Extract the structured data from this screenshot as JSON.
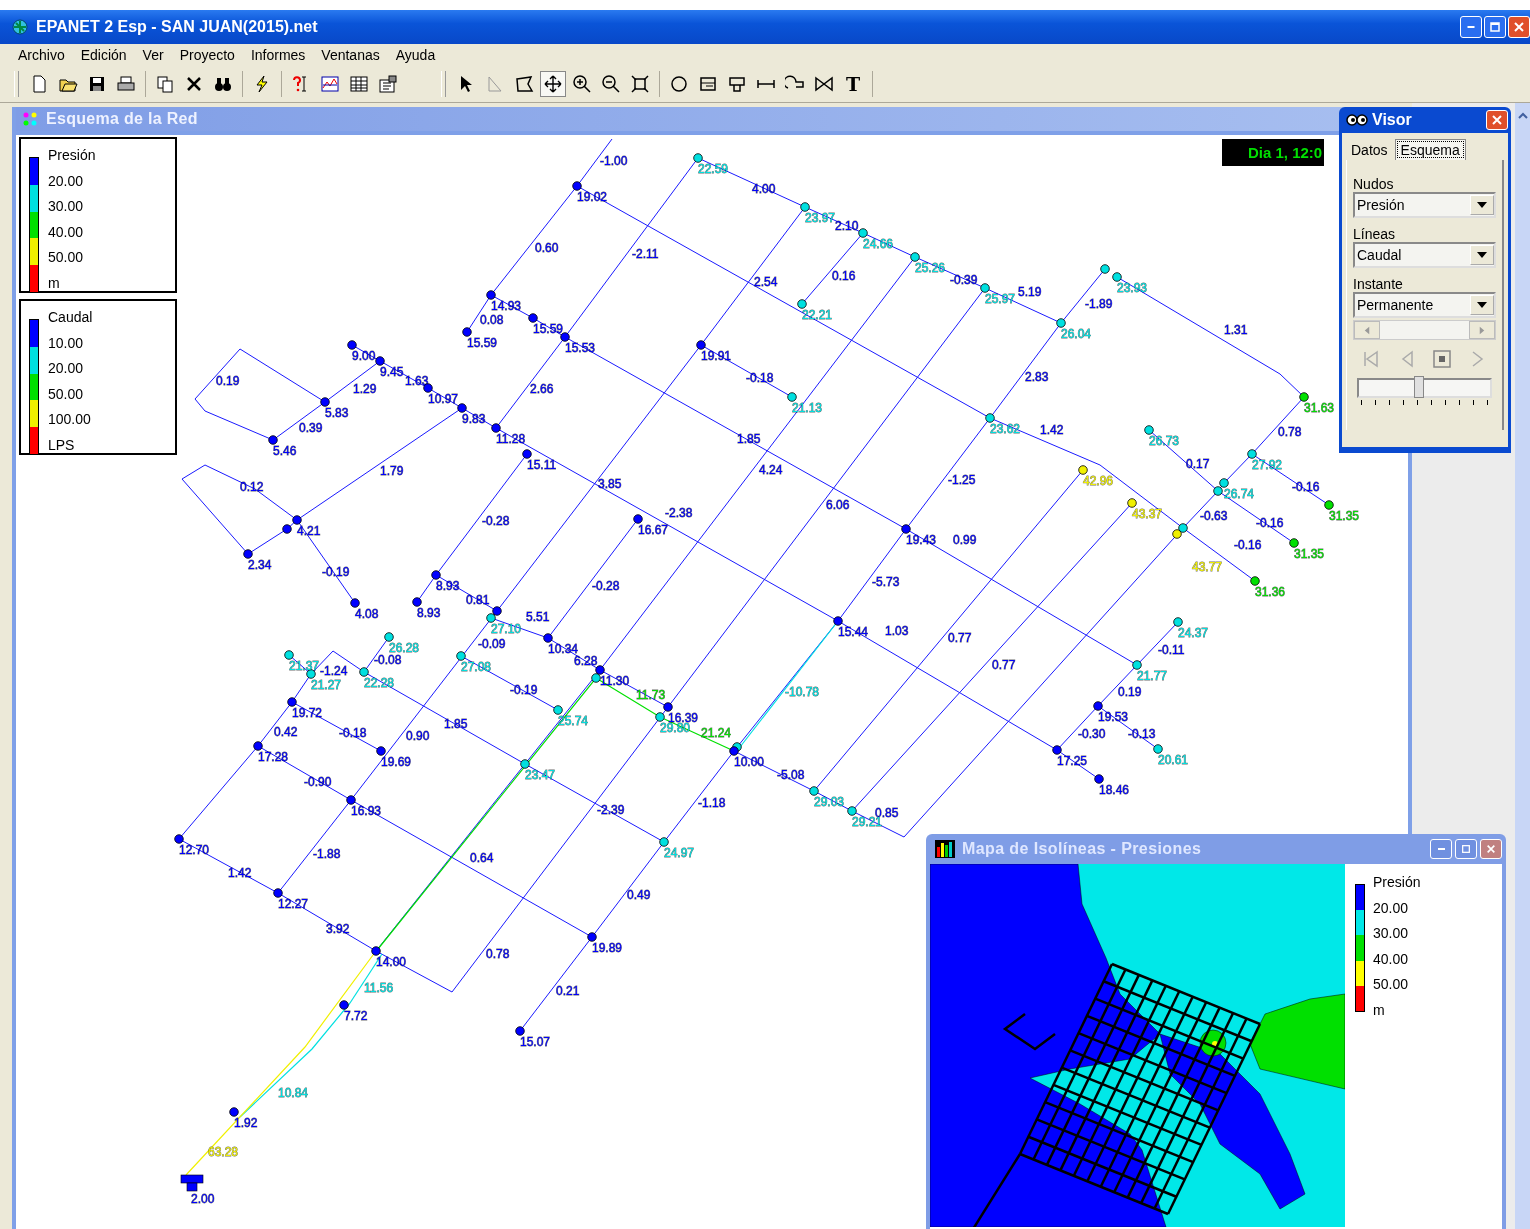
{
  "window": {
    "title": "EPANET 2 Esp - SAN JUAN(2015).net"
  },
  "menu": [
    "Archivo",
    "Edición",
    "Ver",
    "Proyecto",
    "Informes",
    "Ventanas",
    "Ayuda"
  ],
  "toolbar": {
    "text_tool": "T"
  },
  "network_map": {
    "title": "Esquema de la Red",
    "time_display": "Dia 1, 12:0",
    "pressure_legend": {
      "title": "Presión",
      "breaks": [
        "20.00",
        "30.00",
        "40.00",
        "50.00"
      ],
      "unit": "m",
      "bands": [
        {
          "color": "#0000ff"
        },
        {
          "color": "#00e0e0"
        },
        {
          "color": "#00e000"
        },
        {
          "color": "#f0f000"
        },
        {
          "color": "#ff0000"
        }
      ]
    },
    "flow_legend": {
      "title": "Caudal",
      "breaks": [
        "10.00",
        "20.00",
        "50.00",
        "100.00"
      ],
      "unit": "LPS",
      "bands": [
        {
          "color": "#0000ff"
        },
        {
          "color": "#00e0e0"
        },
        {
          "color": "#00e000"
        },
        {
          "color": "#f0f000"
        },
        {
          "color": "#ff0000"
        }
      ]
    },
    "reservoir": {
      "label": "2.00"
    },
    "nodes": [
      {
        "label": "19.02",
        "color": "#0000ff"
      },
      {
        "label": "22.59",
        "color": "#00e0e0"
      },
      {
        "label": "23.97",
        "color": "#00e0e0"
      },
      {
        "label": "24.66",
        "color": "#00e0e0"
      },
      {
        "label": "25.26",
        "color": "#00e0e0"
      },
      {
        "label": "25.97",
        "color": "#00e0e0"
      },
      {
        "label": "26.04",
        "color": "#00e0e0"
      },
      {
        "color": "#00e0e0"
      },
      {
        "label": "23.93",
        "color": "#00e0e0"
      },
      {
        "label": "31.63",
        "color": "#00e000"
      },
      {
        "label": "14.93",
        "color": "#0000ff"
      },
      {
        "label": "15.59",
        "color": "#0000ff"
      },
      {
        "label": "15.59",
        "color": "#0000ff"
      },
      {
        "label": "15.53",
        "color": "#0000ff"
      },
      {
        "label": "19.91",
        "color": "#0000ff"
      },
      {
        "label": "22.21",
        "color": "#00e0e0"
      },
      {
        "label": "21.13",
        "color": "#00e0e0"
      },
      {
        "label": "23.62",
        "color": "#00e0e0"
      },
      {
        "label": "19.43",
        "color": "#0000ff"
      },
      {
        "label": "15.44",
        "color": "#0000ff"
      },
      {
        "label": "9.00",
        "color": "#0000ff"
      },
      {
        "label": "9.45",
        "color": "#0000ff"
      },
      {
        "label": "5.83",
        "color": "#0000ff"
      },
      {
        "label": "5.46",
        "color": "#0000ff"
      },
      {
        "label": "10.97",
        "color": "#0000ff"
      },
      {
        "label": "9.83",
        "color": "#0000ff"
      },
      {
        "label": "11.28",
        "color": "#0000ff"
      },
      {
        "label": "15.11",
        "color": "#0000ff"
      },
      {
        "label": "4.21",
        "color": "#0000ff"
      },
      {
        "color": "#0000ff"
      },
      {
        "label": "2.34",
        "color": "#0000ff"
      },
      {
        "label": "4.08",
        "color": "#0000ff"
      },
      {
        "label": "8.93",
        "color": "#0000ff"
      },
      {
        "label": "8.93",
        "color": "#0000ff"
      },
      {
        "color": "#0000ff"
      },
      {
        "label": "27.10",
        "color": "#00e0e0"
      },
      {
        "label": "10.34",
        "color": "#0000ff"
      },
      {
        "label": "16.67",
        "color": "#0000ff"
      },
      {
        "label": "11.30",
        "color": "#0000ff"
      },
      {
        "color": "#00e0e0"
      },
      {
        "label": "16.39",
        "color": "#0000ff"
      },
      {
        "label": "29.80",
        "color": "#00e0e0"
      },
      {
        "color": "#00e0e0"
      },
      {
        "label": "10.00",
        "color": "#0000ff"
      },
      {
        "label": "29.03",
        "color": "#00e0e0"
      },
      {
        "label": "29.21",
        "color": "#00e0e0"
      },
      {
        "label": "24.97",
        "color": "#00e0e0"
      },
      {
        "label": "19.89",
        "color": "#0000ff"
      },
      {
        "label": "15.07",
        "color": "#0000ff"
      },
      {
        "label": "25.74",
        "color": "#00e0e0"
      },
      {
        "label": "23.47",
        "color": "#00e0e0"
      },
      {
        "label": "27.08",
        "color": "#00e0e0"
      },
      {
        "label": "26.28",
        "color": "#00e0e0"
      },
      {
        "label": "22.28",
        "color": "#00e0e0"
      },
      {
        "label": "21.37",
        "color": "#00e0e0"
      },
      {
        "label": "21.27",
        "color": "#00e0e0"
      },
      {
        "label": "19.72",
        "color": "#0000ff"
      },
      {
        "label": "17.28",
        "color": "#0000ff"
      },
      {
        "label": "19.69",
        "color": "#0000ff"
      },
      {
        "label": "16.93",
        "color": "#0000ff"
      },
      {
        "label": "12.70",
        "color": "#0000ff"
      },
      {
        "label": "12.27",
        "color": "#0000ff"
      },
      {
        "label": "14.00",
        "color": "#0000ff"
      },
      {
        "label": "7.72",
        "color": "#0000ff"
      },
      {
        "label": "1.92",
        "color": "#0000ff"
      },
      {
        "label": "42.96",
        "color": "#f0f000"
      },
      {
        "label": "43.37",
        "color": "#f0f000"
      },
      {
        "label": "43.77",
        "color": "#f0f000"
      },
      {
        "color": "#00e0e0"
      },
      {
        "label": "26.73",
        "color": "#00e0e0"
      },
      {
        "label": "27.92",
        "color": "#00e0e0"
      },
      {
        "label": "26.74",
        "color": "#00e0e0"
      },
      {
        "color": "#00e0e0"
      },
      {
        "label": "31.35",
        "color": "#00e000"
      },
      {
        "label": "31.35",
        "color": "#00e000"
      },
      {
        "label": "31.36",
        "color": "#00e000"
      },
      {
        "label": "24.37",
        "color": "#00e0e0"
      },
      {
        "label": "21.77",
        "color": "#00e0e0"
      },
      {
        "label": "19.53",
        "color": "#0000ff"
      },
      {
        "label": "17.25",
        "color": "#0000ff"
      },
      {
        "label": "20.61",
        "color": "#00e0e0"
      },
      {
        "label": "18.46",
        "color": "#0000ff"
      }
    ],
    "pipes": [
      {
        "label": "-1.00",
        "color": "#0000ff"
      },
      {
        "label": "4.00",
        "color": "#0000ff"
      },
      {
        "label": "2.10",
        "color": "#0000ff"
      },
      {
        "label": "-0.39",
        "color": "#0000ff"
      },
      {
        "label": "5.19",
        "color": "#0000ff"
      },
      {
        "label": "-1.89",
        "color": "#0000ff"
      },
      {
        "label": "1.31",
        "color": "#0000ff"
      },
      {
        "label": "0.60",
        "color": "#0000ff"
      },
      {
        "label": "-2.11",
        "color": "#0000ff"
      },
      {
        "label": "2.54",
        "color": "#0000ff"
      },
      {
        "label": "0.16",
        "color": "#0000ff"
      },
      {
        "label": "0.08",
        "color": "#0000ff"
      },
      {
        "label": "2.66",
        "color": "#0000ff"
      },
      {
        "label": "-0.18",
        "color": "#0000ff"
      },
      {
        "label": "2.83",
        "color": "#0000ff"
      },
      {
        "label": "1.42",
        "color": "#0000ff"
      },
      {
        "label": "0.78",
        "color": "#0000ff"
      },
      {
        "label": "0.17",
        "color": "#0000ff"
      },
      {
        "label": "-0.16",
        "color": "#0000ff"
      },
      {
        "label": "-0.63",
        "color": "#0000ff"
      },
      {
        "label": "-0.16",
        "color": "#0000ff"
      },
      {
        "label": "-0.16",
        "color": "#0000ff"
      },
      {
        "label": "1.85",
        "color": "#0000ff"
      },
      {
        "label": "4.24",
        "color": "#0000ff"
      },
      {
        "label": "-1.25",
        "color": "#0000ff"
      },
      {
        "label": "6.06",
        "color": "#0000ff"
      },
      {
        "label": "0.99",
        "color": "#0000ff"
      },
      {
        "label": "-5.73",
        "color": "#0000ff"
      },
      {
        "label": "1.03",
        "color": "#0000ff"
      },
      {
        "label": "0.77",
        "color": "#0000ff"
      },
      {
        "label": "0.77",
        "color": "#0000ff"
      },
      {
        "label": "-0.11",
        "color": "#0000ff"
      },
      {
        "label": "0.19",
        "color": "#0000ff"
      },
      {
        "label": "-0.30",
        "color": "#0000ff"
      },
      {
        "label": "-0.13",
        "color": "#0000ff"
      },
      {
        "label": "0.19",
        "color": "#0000ff"
      },
      {
        "label": "1.29",
        "color": "#0000ff"
      },
      {
        "label": "0.39",
        "color": "#0000ff"
      },
      {
        "label": "1.63",
        "color": "#0000ff"
      },
      {
        "label": "1.79",
        "color": "#0000ff"
      },
      {
        "label": "0.12",
        "color": "#0000ff"
      },
      {
        "label": "-0.19",
        "color": "#0000ff"
      },
      {
        "label": "3.85",
        "color": "#0000ff"
      },
      {
        "label": "-2.38",
        "color": "#0000ff"
      },
      {
        "label": "-0.28",
        "color": "#0000ff"
      },
      {
        "label": "-0.28",
        "color": "#0000ff"
      },
      {
        "label": "0.81",
        "color": "#0000ff"
      },
      {
        "label": "5.51",
        "color": "#0000ff"
      },
      {
        "label": "-0.09",
        "color": "#0000ff"
      },
      {
        "label": "-0.08",
        "color": "#0000ff"
      },
      {
        "label": "6.28",
        "color": "#0000ff"
      },
      {
        "label": "-1.24",
        "color": "#0000ff"
      },
      {
        "label": "-0.19",
        "color": "#0000ff"
      },
      {
        "label": "11.73",
        "color": "#00e000"
      },
      {
        "label": "21.24",
        "color": "#00e000"
      },
      {
        "label": "-10.78",
        "color": "#00e0e0"
      },
      {
        "label": "0.90",
        "color": "#0000ff"
      },
      {
        "label": "1.85",
        "color": "#0000ff"
      },
      {
        "label": "0.42",
        "color": "#0000ff"
      },
      {
        "label": "-0.18",
        "color": "#0000ff"
      },
      {
        "label": "-0.90",
        "color": "#0000ff"
      },
      {
        "label": "-5.08",
        "color": "#0000ff"
      },
      {
        "label": "-2.39",
        "color": "#0000ff"
      },
      {
        "label": "-1.18",
        "color": "#0000ff"
      },
      {
        "label": "0.85",
        "color": "#0000ff"
      },
      {
        "label": "-1.88",
        "color": "#0000ff"
      },
      {
        "label": "0.64",
        "color": "#0000ff"
      },
      {
        "label": "1.42",
        "color": "#0000ff"
      },
      {
        "label": "3.92",
        "color": "#0000ff"
      },
      {
        "label": "0.49",
        "color": "#0000ff"
      },
      {
        "label": "0.78",
        "color": "#0000ff"
      },
      {
        "label": "11.56",
        "color": "#00e0e0"
      },
      {
        "label": "0.21",
        "color": "#0000ff"
      },
      {
        "label": "10.84",
        "color": "#00e0e0"
      },
      {
        "label": "63.28",
        "color": "#f0f000"
      }
    ]
  },
  "visor": {
    "title": "Visor",
    "tabs": [
      {
        "label": "Datos",
        "selected": false
      },
      {
        "label": "Esquema",
        "selected": true
      }
    ],
    "fields": [
      {
        "label": "Nudos",
        "value": "Presión"
      },
      {
        "label": "Líneas",
        "value": "Caudal"
      },
      {
        "label": "Instante",
        "value": "Permanente"
      }
    ],
    "speed_slider": {
      "level": 0.45
    }
  },
  "contour_map": {
    "title": "Mapa de Isolíneas - Presiones",
    "legend": {
      "title": "Presión",
      "breaks": [
        "20.00",
        "30.00",
        "40.00",
        "50.00"
      ],
      "unit": "m",
      "bands": [
        {
          "color": "#0000ff"
        },
        {
          "color": "#00e8e8"
        },
        {
          "color": "#00e000"
        },
        {
          "color": "#ffff00"
        },
        {
          "color": "#ff0000"
        }
      ]
    }
  }
}
